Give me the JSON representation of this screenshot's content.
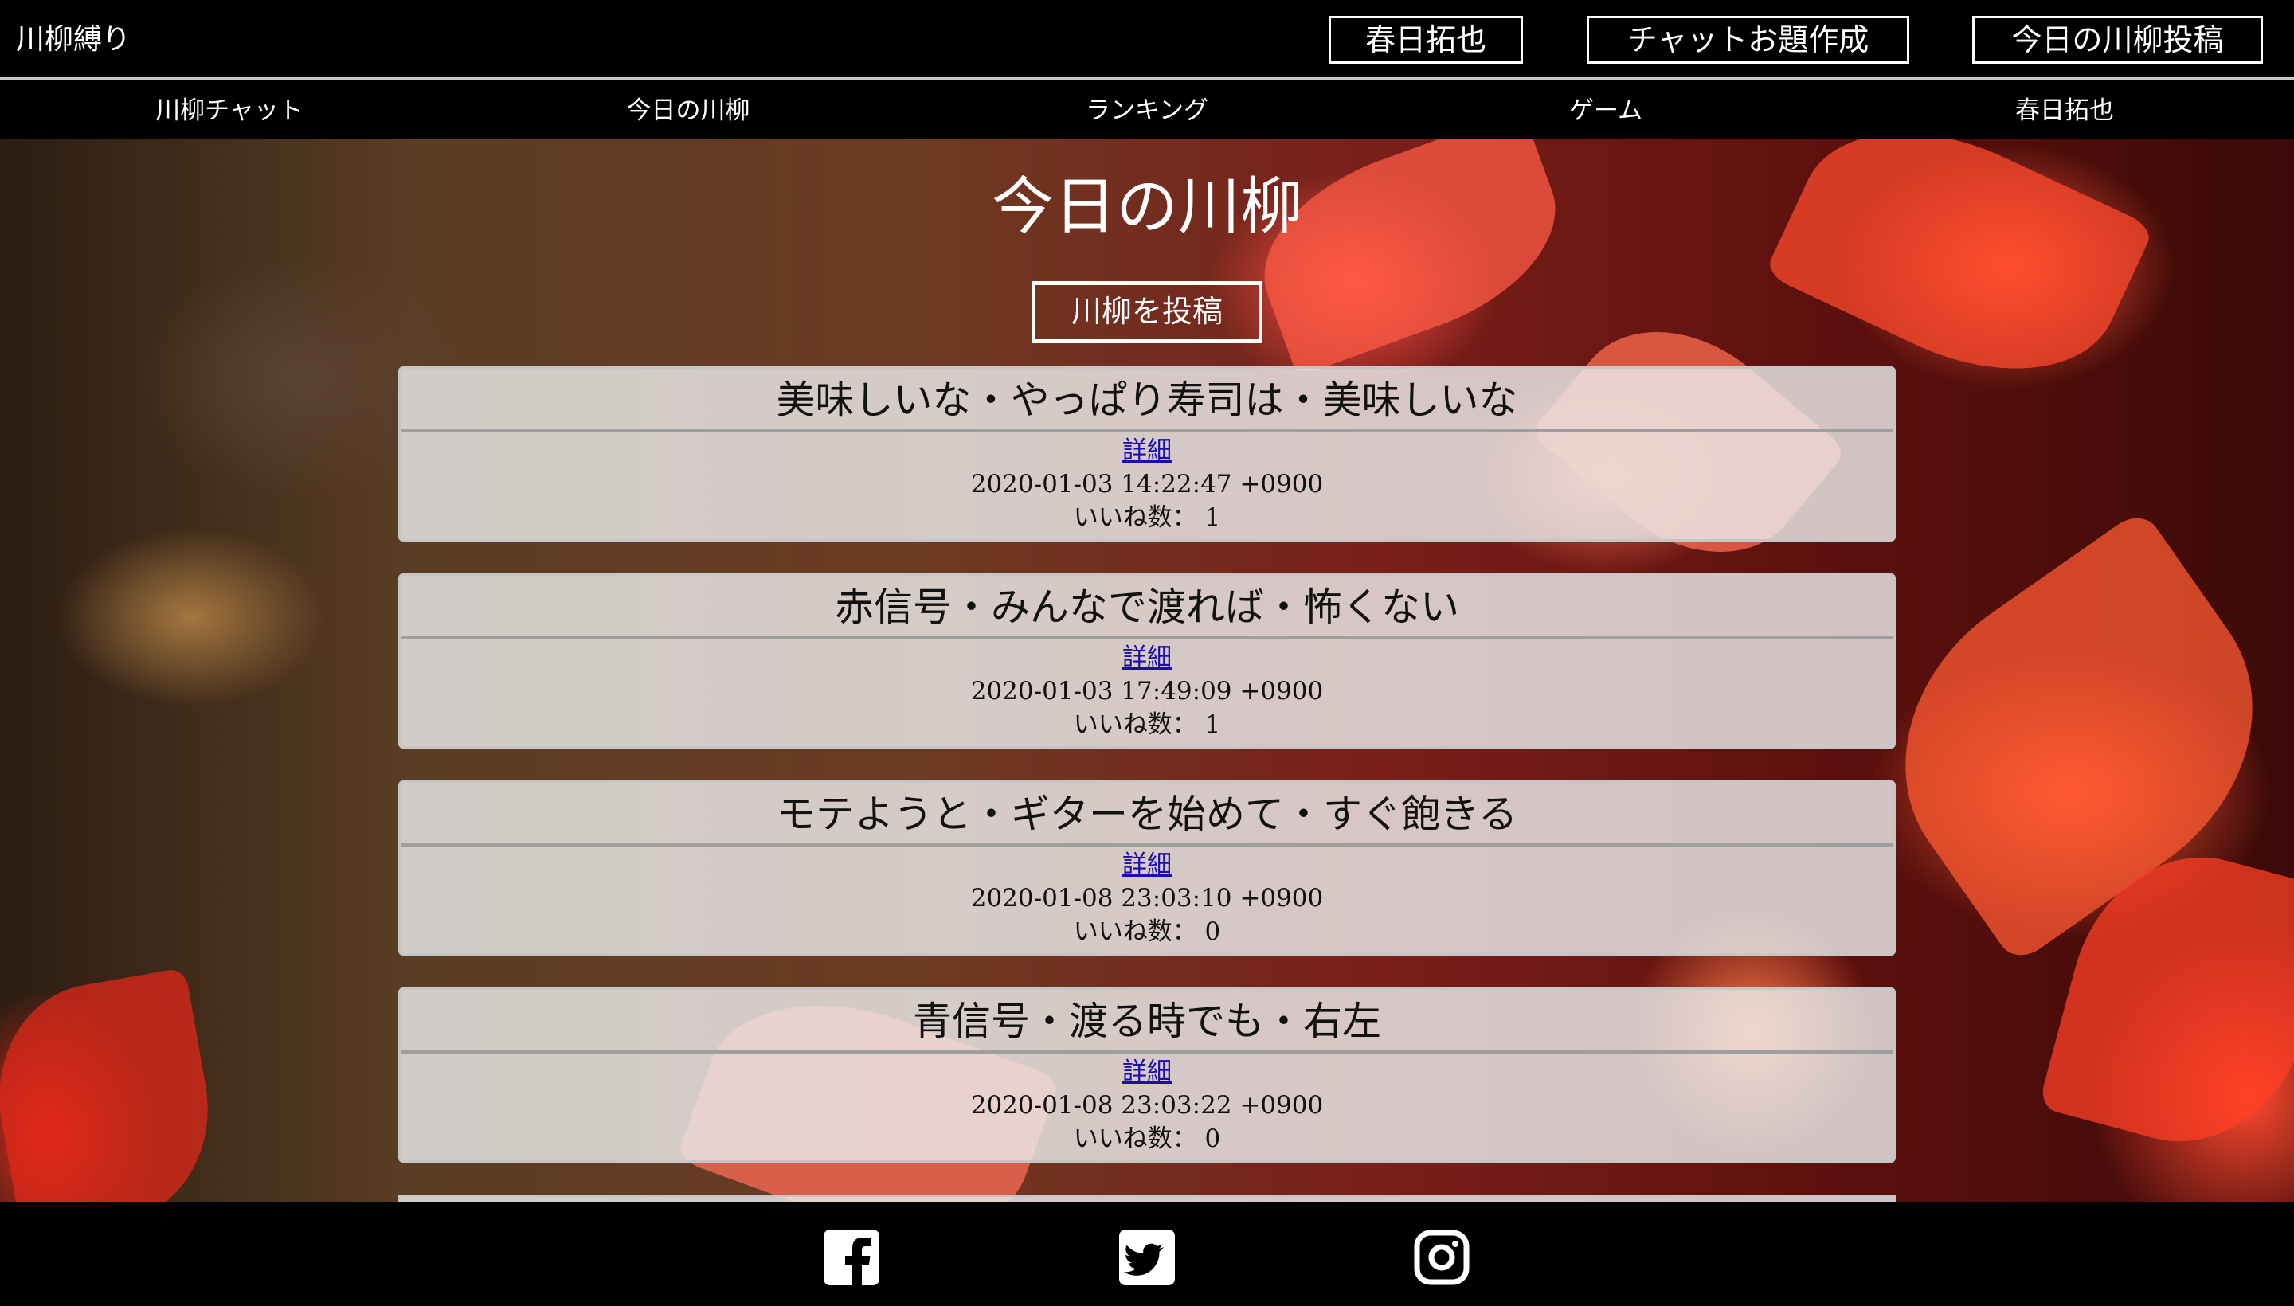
{
  "header": {
    "brand": "川柳縛り",
    "buttons": [
      {
        "label": "春日拓也"
      },
      {
        "label": "チャットお題作成"
      },
      {
        "label": "今日の川柳投稿"
      }
    ]
  },
  "nav": {
    "items": [
      {
        "label": "川柳チャット"
      },
      {
        "label": "今日の川柳"
      },
      {
        "label": "ランキング"
      },
      {
        "label": "ゲーム"
      },
      {
        "label": "春日拓也"
      }
    ]
  },
  "main": {
    "title": "今日の川柳",
    "post_button": "川柳を投稿",
    "detail_label": "詳細",
    "posts": [
      {
        "text": "美味しいな・やっぱり寿司は・美味しいな",
        "detail": "詳細",
        "timestamp": "2020-01-03 14:22:47 +0900",
        "likes": "いいね数： 1"
      },
      {
        "text": "赤信号・みんなで渡れば・怖くない",
        "detail": "詳細",
        "timestamp": "2020-01-03 17:49:09 +0900",
        "likes": "いいね数： 1"
      },
      {
        "text": "モテようと・ギターを始めて・すぐ飽きる",
        "detail": "詳細",
        "timestamp": "2020-01-08 23:03:10 +0900",
        "likes": "いいね数： 0"
      },
      {
        "text": "青信号・渡る時でも・右左",
        "detail": "詳細",
        "timestamp": "2020-01-08 23:03:22 +0900",
        "likes": "いいね数： 0"
      }
    ]
  },
  "footer": {
    "icons": [
      "facebook-icon",
      "twitter-icon",
      "instagram-icon"
    ]
  },
  "colors": {
    "header_bg": "#000000",
    "link": "#1a0dab",
    "card_bg": "#ebebeb"
  }
}
